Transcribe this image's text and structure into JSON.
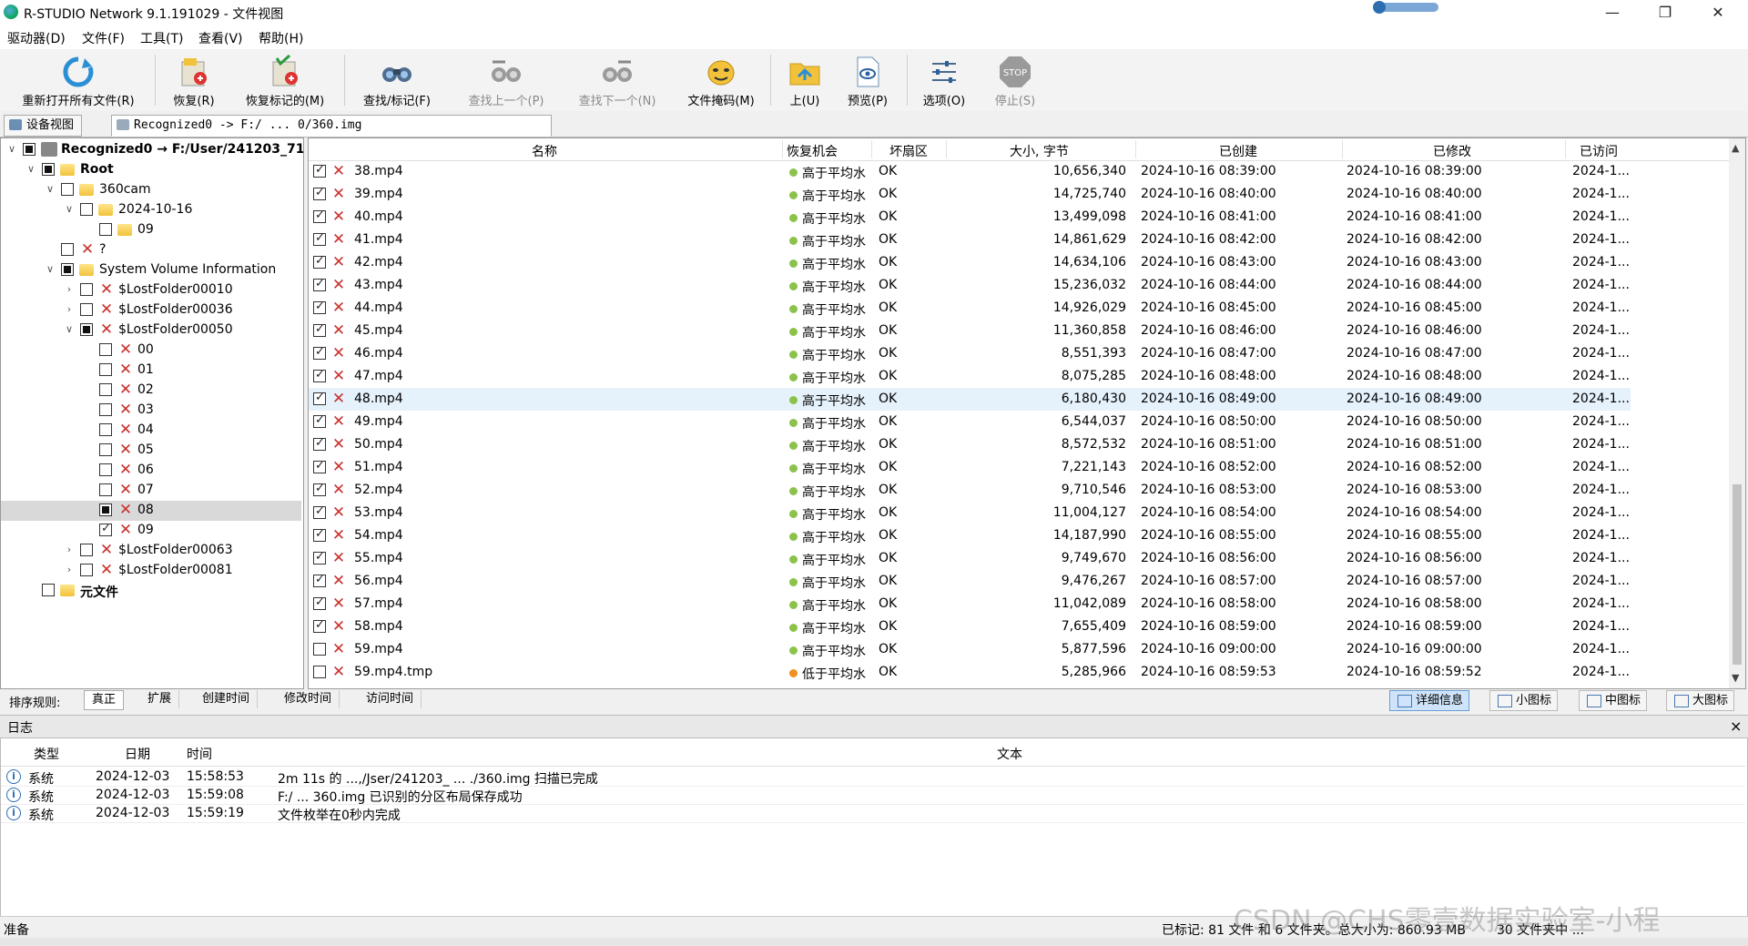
{
  "window": {
    "title": "R-STUDIO Network 9.1.191029 - 文件视图",
    "minimize": "—",
    "maximize": "❐",
    "close": "✕"
  },
  "menu": [
    "驱动器(D)",
    "文件(F)",
    "工具(T)",
    "查看(V)",
    "帮助(H)"
  ],
  "toolbar": [
    {
      "label": "重新打开所有文件(R)",
      "icon": "reopen-icon",
      "enabled": true
    },
    {
      "label": "恢复(R)",
      "icon": "recover-icon",
      "enabled": true
    },
    {
      "label": "恢复标记的(M)",
      "icon": "recover-marked-icon",
      "enabled": true
    },
    {
      "label": "查找/标记(F)",
      "icon": "binoculars-icon",
      "enabled": true
    },
    {
      "label": "查找上一个(P)",
      "icon": "find-prev-icon",
      "enabled": false
    },
    {
      "label": "查找下一个(N)",
      "icon": "find-next-icon",
      "enabled": false
    },
    {
      "label": "文件掩码(M)",
      "icon": "mask-icon",
      "enabled": true
    },
    {
      "label": "上(U)",
      "icon": "up-folder-icon",
      "enabled": true
    },
    {
      "label": "预览(P)",
      "icon": "preview-icon",
      "enabled": true
    },
    {
      "label": "选项(O)",
      "icon": "options-icon",
      "enabled": true
    },
    {
      "label": "停止(S)",
      "icon": "stop-icon",
      "enabled": false,
      "icon_text": "STOP"
    }
  ],
  "tabs": [
    {
      "label": "设备视图",
      "active": false
    },
    {
      "label": "Recognized0 -> F:/ ... 0/360.img",
      "active": true
    }
  ],
  "tree": [
    {
      "label": "Recognized0 → F:/User/241203_71",
      "level": 0,
      "expander": "∨",
      "check": "partial",
      "icon": "disk",
      "bold": true
    },
    {
      "label": "Root",
      "level": 1,
      "expander": "∨",
      "check": "partial",
      "icon": "folder",
      "bold": true
    },
    {
      "label": "360cam",
      "level": 2,
      "expander": "∨",
      "check": "none",
      "icon": "folder"
    },
    {
      "label": "2024-10-16",
      "level": 3,
      "expander": "∨",
      "check": "none",
      "icon": "folder"
    },
    {
      "label": "09",
      "level": 4,
      "expander": "",
      "check": "none",
      "icon": "folder"
    },
    {
      "label": "?",
      "level": 2,
      "expander": "",
      "check": "none",
      "icon": "x"
    },
    {
      "label": "System Volume Information",
      "level": 2,
      "expander": "∨",
      "check": "partial",
      "icon": "folder"
    },
    {
      "label": "$LostFolder00010",
      "level": 3,
      "expander": "›",
      "check": "none",
      "icon": "x"
    },
    {
      "label": "$LostFolder00036",
      "level": 3,
      "expander": "›",
      "check": "none",
      "icon": "x"
    },
    {
      "label": "$LostFolder00050",
      "level": 3,
      "expander": "∨",
      "check": "partial",
      "icon": "x"
    },
    {
      "label": "00",
      "level": 4,
      "expander": "",
      "check": "none",
      "icon": "x"
    },
    {
      "label": "01",
      "level": 4,
      "expander": "",
      "check": "none",
      "icon": "x"
    },
    {
      "label": "02",
      "level": 4,
      "expander": "",
      "check": "none",
      "icon": "x"
    },
    {
      "label": "03",
      "level": 4,
      "expander": "",
      "check": "none",
      "icon": "x"
    },
    {
      "label": "04",
      "level": 4,
      "expander": "",
      "check": "none",
      "icon": "x"
    },
    {
      "label": "05",
      "level": 4,
      "expander": "",
      "check": "none",
      "icon": "x"
    },
    {
      "label": "06",
      "level": 4,
      "expander": "",
      "check": "none",
      "icon": "x"
    },
    {
      "label": "07",
      "level": 4,
      "expander": "",
      "check": "none",
      "icon": "x"
    },
    {
      "label": "08",
      "level": 4,
      "expander": "",
      "check": "partial",
      "icon": "x",
      "selected": true
    },
    {
      "label": "09",
      "level": 4,
      "expander": "",
      "check": "checked",
      "icon": "x"
    },
    {
      "label": "$LostFolder00063",
      "level": 3,
      "expander": "›",
      "check": "none",
      "icon": "x"
    },
    {
      "label": "$LostFolder00081",
      "level": 3,
      "expander": "›",
      "check": "none",
      "icon": "x"
    },
    {
      "label": "元文件",
      "level": 1,
      "expander": "",
      "check": "none",
      "icon": "folder",
      "bold": true
    }
  ],
  "file_columns": [
    "名称",
    "恢复机会",
    "坏扇区",
    "大小, 字节",
    "已创建",
    "已修改",
    "已访问"
  ],
  "files": [
    {
      "name": "38.mp4",
      "chance": "高于平均水",
      "bad": "OK",
      "size": "10,656,340",
      "created": "2024-10-16 08:39:00",
      "modified": "2024-10-16 08:39:00",
      "accessed": "2024-1...",
      "checked": true,
      "level": "good"
    },
    {
      "name": "39.mp4",
      "chance": "高于平均水",
      "bad": "OK",
      "size": "14,725,740",
      "created": "2024-10-16 08:40:00",
      "modified": "2024-10-16 08:40:00",
      "accessed": "2024-1...",
      "checked": true,
      "level": "good"
    },
    {
      "name": "40.mp4",
      "chance": "高于平均水",
      "bad": "OK",
      "size": "13,499,098",
      "created": "2024-10-16 08:41:00",
      "modified": "2024-10-16 08:41:00",
      "accessed": "2024-1...",
      "checked": true,
      "level": "good"
    },
    {
      "name": "41.mp4",
      "chance": "高于平均水",
      "bad": "OK",
      "size": "14,861,629",
      "created": "2024-10-16 08:42:00",
      "modified": "2024-10-16 08:42:00",
      "accessed": "2024-1...",
      "checked": true,
      "level": "good"
    },
    {
      "name": "42.mp4",
      "chance": "高于平均水",
      "bad": "OK",
      "size": "14,634,106",
      "created": "2024-10-16 08:43:00",
      "modified": "2024-10-16 08:43:00",
      "accessed": "2024-1...",
      "checked": true,
      "level": "good"
    },
    {
      "name": "43.mp4",
      "chance": "高于平均水",
      "bad": "OK",
      "size": "15,236,032",
      "created": "2024-10-16 08:44:00",
      "modified": "2024-10-16 08:44:00",
      "accessed": "2024-1...",
      "checked": true,
      "level": "good"
    },
    {
      "name": "44.mp4",
      "chance": "高于平均水",
      "bad": "OK",
      "size": "14,926,029",
      "created": "2024-10-16 08:45:00",
      "modified": "2024-10-16 08:45:00",
      "accessed": "2024-1...",
      "checked": true,
      "level": "good"
    },
    {
      "name": "45.mp4",
      "chance": "高于平均水",
      "bad": "OK",
      "size": "11,360,858",
      "created": "2024-10-16 08:46:00",
      "modified": "2024-10-16 08:46:00",
      "accessed": "2024-1...",
      "checked": true,
      "level": "good"
    },
    {
      "name": "46.mp4",
      "chance": "高于平均水",
      "bad": "OK",
      "size": "8,551,393",
      "created": "2024-10-16 08:47:00",
      "modified": "2024-10-16 08:47:00",
      "accessed": "2024-1...",
      "checked": true,
      "level": "good"
    },
    {
      "name": "47.mp4",
      "chance": "高于平均水",
      "bad": "OK",
      "size": "8,075,285",
      "created": "2024-10-16 08:48:00",
      "modified": "2024-10-16 08:48:00",
      "accessed": "2024-1...",
      "checked": true,
      "level": "good"
    },
    {
      "name": "48.mp4",
      "chance": "高于平均水",
      "bad": "OK",
      "size": "6,180,430",
      "created": "2024-10-16 08:49:00",
      "modified": "2024-10-16 08:49:00",
      "accessed": "2024-1...",
      "checked": true,
      "level": "good",
      "selected": true
    },
    {
      "name": "49.mp4",
      "chance": "高于平均水",
      "bad": "OK",
      "size": "6,544,037",
      "created": "2024-10-16 08:50:00",
      "modified": "2024-10-16 08:50:00",
      "accessed": "2024-1...",
      "checked": true,
      "level": "good"
    },
    {
      "name": "50.mp4",
      "chance": "高于平均水",
      "bad": "OK",
      "size": "8,572,532",
      "created": "2024-10-16 08:51:00",
      "modified": "2024-10-16 08:51:00",
      "accessed": "2024-1...",
      "checked": true,
      "level": "good"
    },
    {
      "name": "51.mp4",
      "chance": "高于平均水",
      "bad": "OK",
      "size": "7,221,143",
      "created": "2024-10-16 08:52:00",
      "modified": "2024-10-16 08:52:00",
      "accessed": "2024-1...",
      "checked": true,
      "level": "good"
    },
    {
      "name": "52.mp4",
      "chance": "高于平均水",
      "bad": "OK",
      "size": "9,710,546",
      "created": "2024-10-16 08:53:00",
      "modified": "2024-10-16 08:53:00",
      "accessed": "2024-1...",
      "checked": true,
      "level": "good"
    },
    {
      "name": "53.mp4",
      "chance": "高于平均水",
      "bad": "OK",
      "size": "11,004,127",
      "created": "2024-10-16 08:54:00",
      "modified": "2024-10-16 08:54:00",
      "accessed": "2024-1...",
      "checked": true,
      "level": "good"
    },
    {
      "name": "54.mp4",
      "chance": "高于平均水",
      "bad": "OK",
      "size": "14,187,990",
      "created": "2024-10-16 08:55:00",
      "modified": "2024-10-16 08:55:00",
      "accessed": "2024-1...",
      "checked": true,
      "level": "good"
    },
    {
      "name": "55.mp4",
      "chance": "高于平均水",
      "bad": "OK",
      "size": "9,749,670",
      "created": "2024-10-16 08:56:00",
      "modified": "2024-10-16 08:56:00",
      "accessed": "2024-1...",
      "checked": true,
      "level": "good"
    },
    {
      "name": "56.mp4",
      "chance": "高于平均水",
      "bad": "OK",
      "size": "9,476,267",
      "created": "2024-10-16 08:57:00",
      "modified": "2024-10-16 08:57:00",
      "accessed": "2024-1...",
      "checked": true,
      "level": "good"
    },
    {
      "name": "57.mp4",
      "chance": "高于平均水",
      "bad": "OK",
      "size": "11,042,089",
      "created": "2024-10-16 08:58:00",
      "modified": "2024-10-16 08:58:00",
      "accessed": "2024-1...",
      "checked": true,
      "level": "good"
    },
    {
      "name": "58.mp4",
      "chance": "高于平均水",
      "bad": "OK",
      "size": "7,655,409",
      "created": "2024-10-16 08:59:00",
      "modified": "2024-10-16 08:59:00",
      "accessed": "2024-1...",
      "checked": true,
      "level": "good"
    },
    {
      "name": "59.mp4",
      "chance": "高于平均水",
      "bad": "OK",
      "size": "5,877,596",
      "created": "2024-10-16 09:00:00",
      "modified": "2024-10-16 09:00:00",
      "accessed": "2024-1...",
      "checked": false,
      "level": "good"
    },
    {
      "name": "59.mp4.tmp",
      "chance": "低于平均水",
      "bad": "OK",
      "size": "5,285,966",
      "created": "2024-10-16 08:59:53",
      "modified": "2024-10-16 08:59:52",
      "accessed": "2024-1...",
      "checked": false,
      "level": "low"
    }
  ],
  "status_colors": {
    "good": "#8bc34a",
    "low": "#f0901e"
  },
  "sort": {
    "label": "排序规则:",
    "options": [
      "真正",
      "扩展",
      "创建时间",
      "修改时间",
      "访问时间"
    ],
    "active": 0
  },
  "views": [
    {
      "label": "详细信息",
      "active": true
    },
    {
      "label": "小图标",
      "active": false
    },
    {
      "label": "中图标",
      "active": false
    },
    {
      "label": "大图标",
      "active": false
    }
  ],
  "log": {
    "title": "日志",
    "close": "×",
    "columns": [
      "类型",
      "日期",
      "时间",
      "文本"
    ],
    "rows": [
      {
        "type": "系统",
        "date": "2024-12-03",
        "time": "15:58:53",
        "text": "2m 11s 的 ...,/Jser/241203_ ... ./360.img 扫描已完成"
      },
      {
        "type": "系统",
        "date": "2024-12-03",
        "time": "15:59:08",
        "text": "F:/ ... 360.img 已识别的分区布局保存成功"
      },
      {
        "type": "系统",
        "date": "2024-12-03",
        "time": "15:59:19",
        "text": "文件枚举在0秒内完成"
      }
    ]
  },
  "status": {
    "left": "准备",
    "marked": "已标记: 81 文件 和 6 文件夹。总大小为: 860.93 MB",
    "files": "30 文件夹中 ..."
  },
  "watermark": "CSDN @CHS零壹数据实验室-小程"
}
